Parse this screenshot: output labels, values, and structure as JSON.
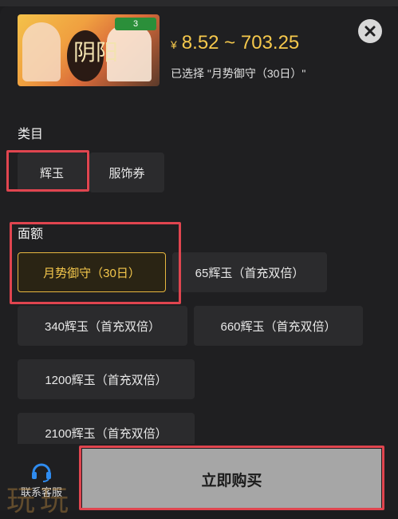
{
  "product": {
    "price_symbol": "¥",
    "price_range": "8.52 ~ 703.25",
    "selected_text": "已选择 \"月势御守（30日）\"",
    "banner_mark": "阴阳",
    "banner_badge": "3"
  },
  "category": {
    "title": "类目",
    "options": [
      {
        "label": "辉玉"
      },
      {
        "label": "服饰券"
      }
    ]
  },
  "denomination": {
    "title": "面额",
    "options": [
      {
        "label": "月势御守（30日）"
      },
      {
        "label": "65辉玉（首充双倍）"
      },
      {
        "label": "340辉玉（首充双倍）"
      },
      {
        "label": "660辉玉（首充双倍）"
      },
      {
        "label": "1200辉玉（首充双倍）"
      },
      {
        "label": "2100辉玉（首充双倍）"
      }
    ]
  },
  "footer": {
    "service_label": "联系客服",
    "buy_label": "立即购买",
    "watermark": "玩玩"
  },
  "colors": {
    "accent": "#f5c84c",
    "highlight_box": "#e0454f",
    "background": "#1f1f21",
    "option_bg": "#2b2b2d",
    "buy_button_bg": "#a6a6a6"
  }
}
